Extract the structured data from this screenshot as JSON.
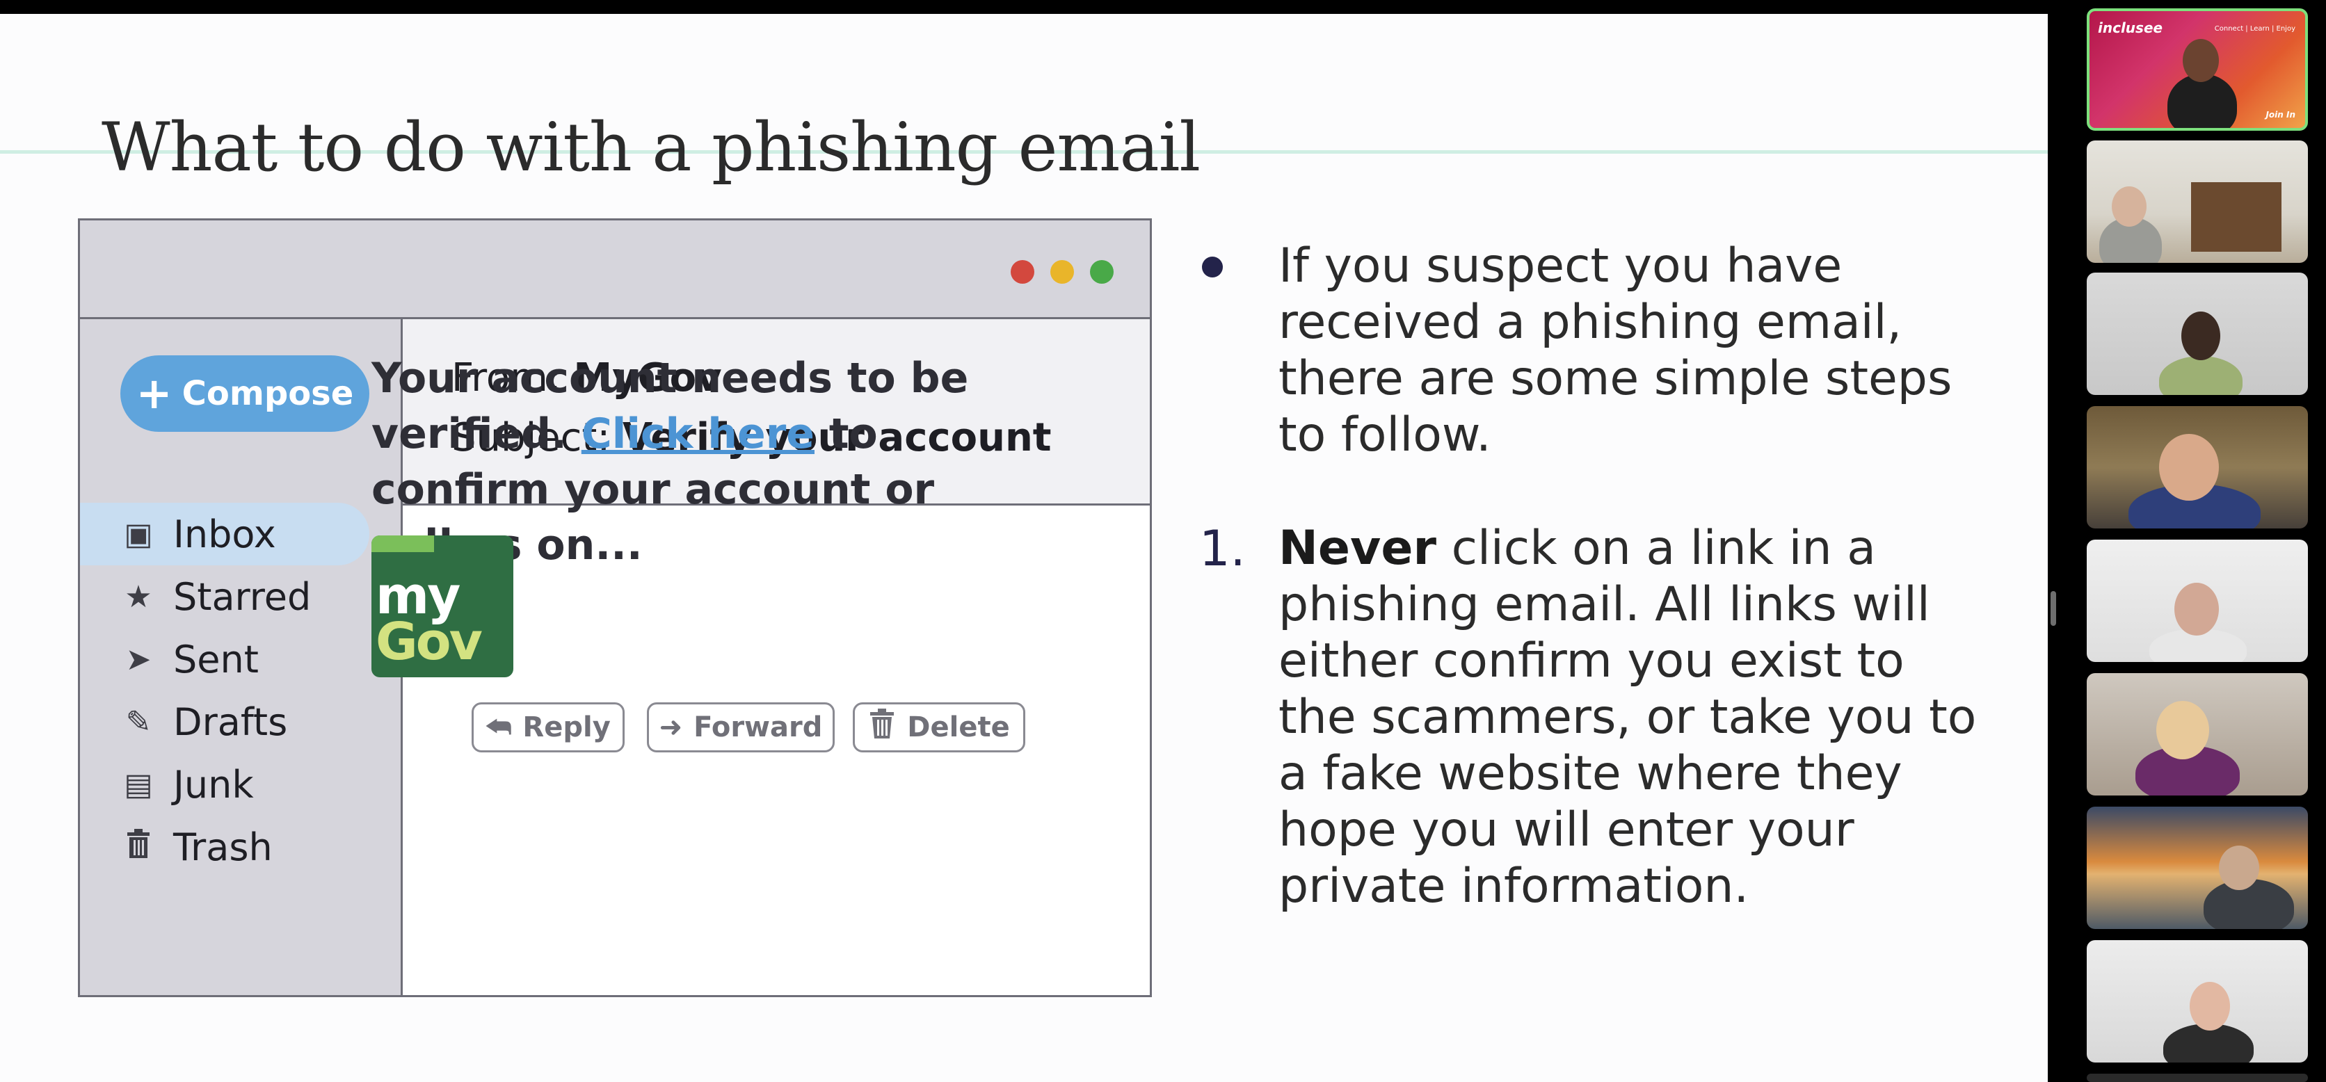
{
  "slide": {
    "title": "What to do with a phishing email"
  },
  "email_mockup": {
    "compose_label": "Compose",
    "folders": [
      "Inbox",
      "Starred",
      "Sent",
      "Drafts",
      "Junk",
      "Trash"
    ],
    "selected_folder": "Inbox",
    "from_label": "From:",
    "from_value": "MyGov",
    "subject_label": "Subject:",
    "subject_value": "Verify your account",
    "body_before_link": "Your account needs to be verified. ",
    "body_link": "Click here",
    "body_after_link": " to confirm your account or call us on...",
    "logo_text_top": "my",
    "logo_text_bottom": "Gov",
    "actions": {
      "reply": "Reply",
      "forward": "Forward",
      "delete": "Delete"
    },
    "window_dots": [
      "#d3483e",
      "#e9b52a",
      "#49a948"
    ],
    "accent_color": "#5fa4dc"
  },
  "content": {
    "bullet": "If you suspect you have received a phishing email, there are some simple steps to follow.",
    "step_number": "1.",
    "step_bold": "Never",
    "step_rest": " click on a link in a phishing email. All links will either confirm you exist to the scammers, or take you to a fake website where they hope you will enter your private information."
  },
  "participants": {
    "presenter_brand": "inclusee",
    "presenter_tagline": "Connect | Learn | Enjoy",
    "presenter_join": "Join In",
    "tile_count": 8,
    "active_speaker_border": "#7de07d"
  }
}
